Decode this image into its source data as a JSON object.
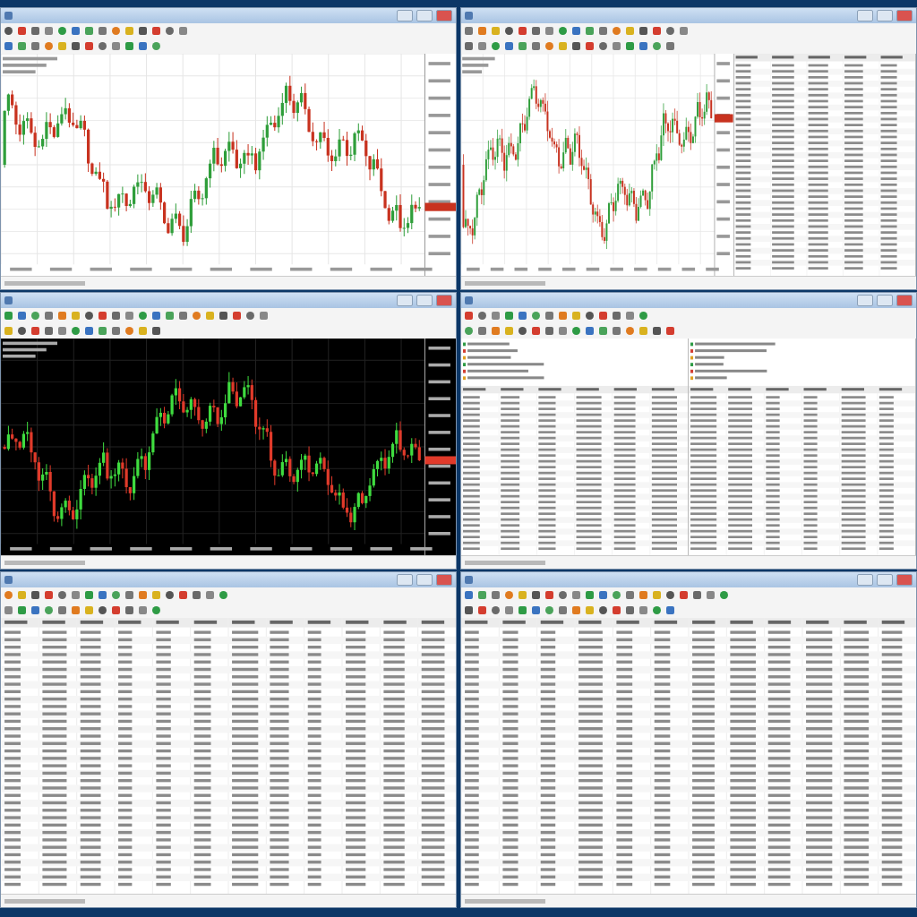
{
  "windows": [
    {
      "kind": "chart",
      "dark_background": false
    },
    {
      "kind": "chart_with_table",
      "dark_background": false
    },
    {
      "kind": "chart",
      "dark_background": true
    },
    {
      "kind": "split_tables"
    },
    {
      "kind": "table"
    },
    {
      "kind": "table"
    }
  ]
}
